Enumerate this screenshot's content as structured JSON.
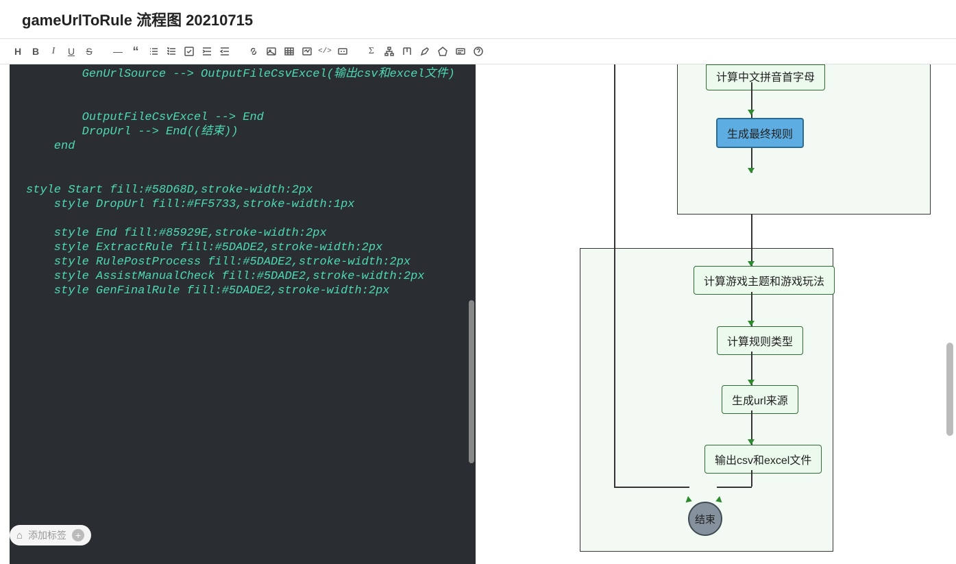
{
  "title": "gameUrlToRule 流程图 20210715",
  "toolbar": {
    "heading": "H",
    "bold": "B",
    "italic": "I",
    "underline": "U",
    "strike": "S",
    "hr": "—",
    "quote": "“",
    "ul": "list",
    "ol": "list-ol",
    "checklist": "check",
    "indent": "indent",
    "outdent": "outdent",
    "link": "link",
    "image": "img",
    "table": "table",
    "media": "media",
    "code": "</>",
    "comp": "comp",
    "formula": "Σ",
    "sitemap": "tree",
    "kanban": "kan",
    "pen": "pen",
    "shape": "shape",
    "card": "card",
    "help": "?"
  },
  "code": {
    "lines": [
      "        GenUrlSource --> OutputFileCsvExcel(输出csv和excel文件)",
      "",
      "",
      "        OutputFileCsvExcel --> End",
      "        DropUrl --> End((结束))",
      "    end",
      "",
      "",
      "style Start fill:#58D68D,stroke-width:2px",
      "    style DropUrl fill:#FF5733,stroke-width:1px",
      "",
      "    style End fill:#85929E,stroke-width:2px",
      "    style ExtractRule fill:#5DADE2,stroke-width:2px",
      "    style RulePostProcess fill:#5DADE2,stroke-width:2px",
      "    style AssistManualCheck fill:#5DADE2,stroke-width:2px",
      "    style GenFinalRule fill:#5DADE2,stroke-width:2px"
    ]
  },
  "diagram": {
    "nodes": {
      "pinyin": "计算中文拼音首字母",
      "gen_final": "生成最终规则",
      "theme": "计算游戏主题和游戏玩法",
      "rule_type": "计算规则类型",
      "url_source": "生成url来源",
      "output": "输出csv和excel文件",
      "end": "结束"
    }
  },
  "tagbar": {
    "placeholder": "添加标签"
  }
}
